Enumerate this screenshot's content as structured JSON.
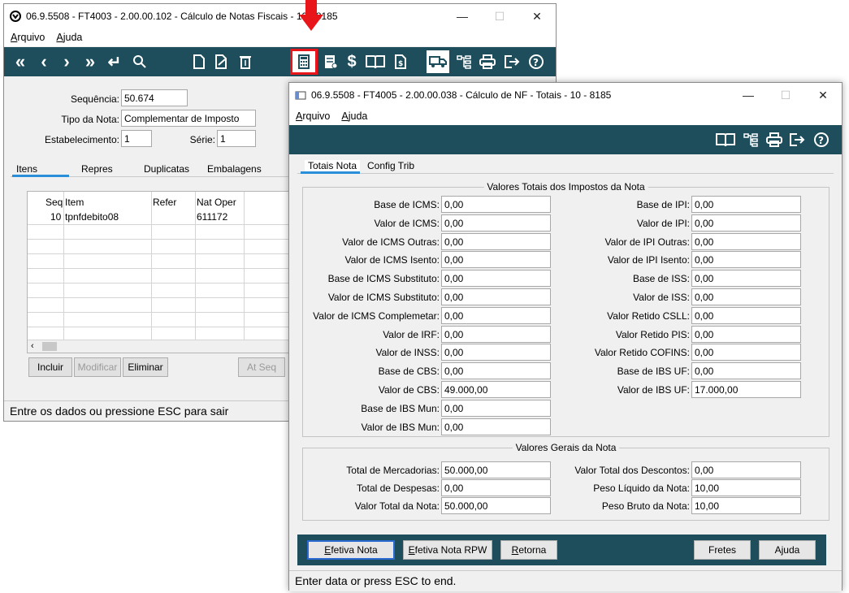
{
  "win1": {
    "title": "06.9.5508 - FT4003 - 2.00.00.102 - Cálculo de Notas Fiscais - 10 - 8185",
    "menu": [
      "Arquivo",
      "Ajuda"
    ],
    "fields": {
      "sequencia_label": "Sequência:",
      "sequencia_value": "50.674",
      "tipo_label": "Tipo da Nota:",
      "tipo_value": "Complementar de Imposto",
      "estab_label": "Estabelecimento:",
      "estab_value": "1",
      "serie_label": "Série:",
      "serie_value": "1"
    },
    "tabs": [
      "Itens",
      "Repres",
      "Duplicatas",
      "Embalagens"
    ],
    "grid": {
      "headers": [
        "Seq",
        "Item",
        "Refer",
        "Nat Oper"
      ],
      "rows": [
        [
          "10",
          "tpnfdebito08",
          "",
          "611172"
        ]
      ]
    },
    "buttons": {
      "incluir": "Incluir",
      "modificar": "Modificar",
      "eliminar": "Eliminar",
      "atseq": "At Seq"
    },
    "status": "Entre os dados ou pressione ESC para sair"
  },
  "win2": {
    "title": "06.9.5508 - FT4005 - 2.00.00.038 - Cálculo de NF - Totais - 10 - 8185",
    "menu": [
      "Arquivo",
      "Ajuda"
    ],
    "tabs": [
      "Totais Nota",
      "Config Trib"
    ],
    "group1_title": "Valores Totais dos Impostos da Nota",
    "left": [
      {
        "label": "Base de ICMS:",
        "value": "0,00"
      },
      {
        "label": "Valor de ICMS:",
        "value": "0,00"
      },
      {
        "label": "Valor de ICMS Outras:",
        "value": "0,00"
      },
      {
        "label": "Valor de ICMS Isento:",
        "value": "0,00"
      },
      {
        "label": "Base de ICMS Substituto:",
        "value": "0,00"
      },
      {
        "label": "Valor de ICMS Substituto:",
        "value": "0,00"
      },
      {
        "label": "Valor de ICMS Complemetar:",
        "value": "0,00"
      },
      {
        "label": "Valor de IRF:",
        "value": "0,00"
      },
      {
        "label": "Valor de INSS:",
        "value": "0,00"
      },
      {
        "label": "Base de CBS:",
        "value": "0,00"
      },
      {
        "label": "Valor de CBS:",
        "value": "49.000,00"
      },
      {
        "label": "Base de IBS Mun:",
        "value": "0,00"
      },
      {
        "label": "Valor de IBS Mun:",
        "value": "0,00"
      }
    ],
    "right": [
      {
        "label": "Base de IPI:",
        "value": "0,00"
      },
      {
        "label": "Valor de IPI:",
        "value": "0,00"
      },
      {
        "label": "Valor de IPI Outras:",
        "value": "0,00"
      },
      {
        "label": "Valor de IPI Isento:",
        "value": "0,00"
      },
      {
        "label": "Base de ISS:",
        "value": "0,00"
      },
      {
        "label": "Valor de ISS:",
        "value": "0,00"
      },
      {
        "label": "Valor Retido CSLL:",
        "value": "0,00"
      },
      {
        "label": "Valor Retido PIS:",
        "value": "0,00"
      },
      {
        "label": "Valor Retido COFINS:",
        "value": "0,00"
      },
      {
        "label": "Base de IBS UF:",
        "value": "0,00"
      },
      {
        "label": "Valor de IBS UF:",
        "value": "17.000,00"
      }
    ],
    "group2_title": "Valores Gerais da Nota",
    "g2left": [
      {
        "label": "Total de Mercadorias:",
        "value": "50.000,00"
      },
      {
        "label": "Total de Despesas:",
        "value": "0,00"
      },
      {
        "label": "Valor Total da Nota:",
        "value": "50.000,00"
      }
    ],
    "g2right": [
      {
        "label": "Valor Total dos Descontos:",
        "value": "0,00"
      },
      {
        "label": "Peso Líquido da Nota:",
        "value": "10,00"
      },
      {
        "label": "Peso Bruto da Nota:",
        "value": "10,00"
      }
    ],
    "buttons": {
      "efetiva": "Efetiva Nota",
      "efetiva_rpw": "Efetiva Nota RPW",
      "retorna": "Retorna",
      "fretes": "Fretes",
      "ajuda": "Ajuda"
    },
    "status": "Enter data or press ESC to end."
  },
  "icons": {
    "w1_toolbar": [
      "first-icon",
      "prev-icon",
      "next-icon",
      "last-icon",
      "return-icon",
      "search-icon",
      "new-doc-icon",
      "edit-doc-icon",
      "trash-icon",
      "calculator-icon",
      "document-list-icon",
      "dollar-icon",
      "book-icon",
      "document-icon",
      "truck-icon",
      "tree-icon",
      "print-icon",
      "exit-icon",
      "help-icon"
    ],
    "w2_toolbar": [
      "book-icon",
      "tree-icon",
      "print-icon",
      "exit-icon",
      "help-icon"
    ]
  },
  "colors": {
    "toolbar": "#1e4d5c",
    "highlight": "#e8161b",
    "focus": "#2a6ad0"
  }
}
